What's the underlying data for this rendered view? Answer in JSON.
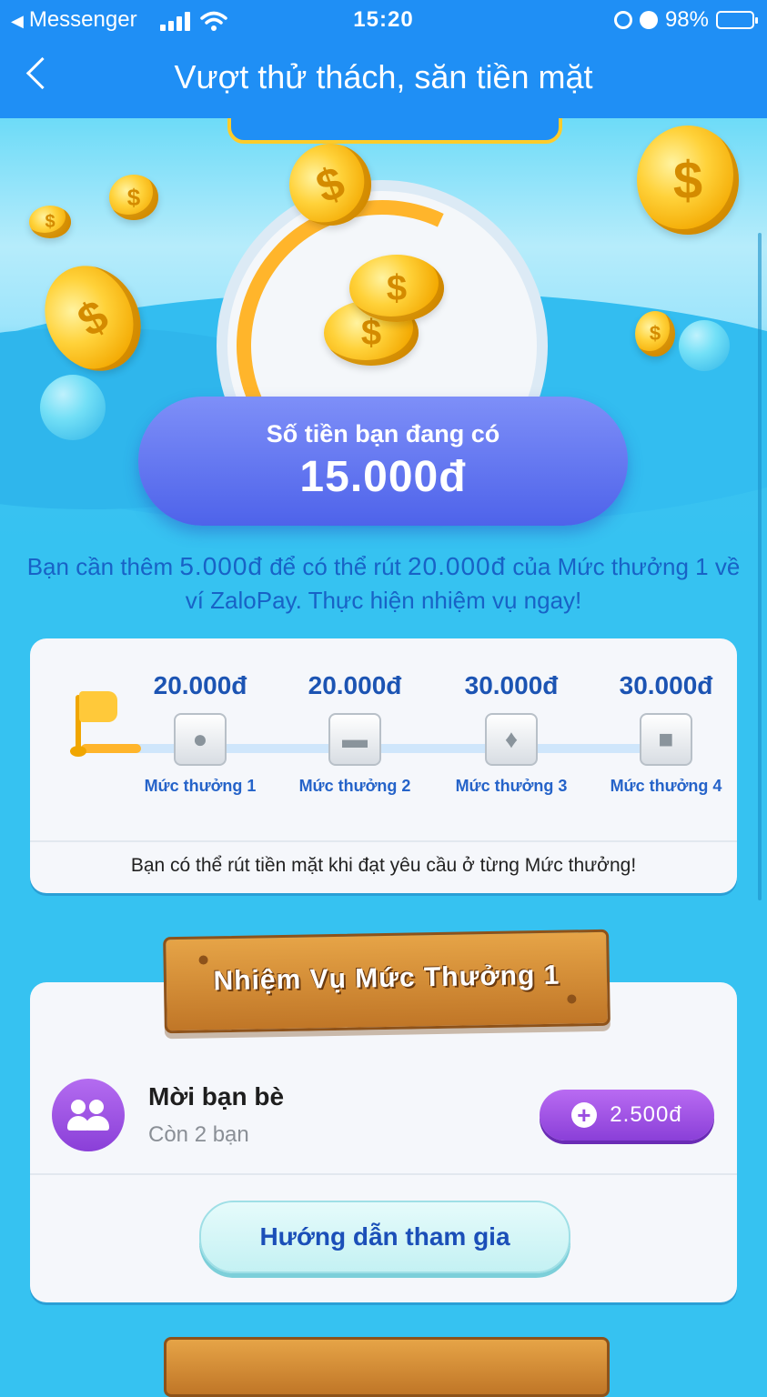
{
  "status_bar": {
    "back_app": "Messenger",
    "time": "15:20",
    "battery": "98%"
  },
  "header": {
    "title": "Vượt thử thách, săn tiền mặt"
  },
  "hero": {
    "coin_symbol": "$"
  },
  "balance": {
    "label": "Số tiền bạn đang có",
    "amount": "15.000đ"
  },
  "need_message": {
    "part1": "Bạn cần thêm ",
    "need_amount": "5.000đ",
    "part2": " để có thể rút ",
    "withdraw_amount": "20.000đ",
    "part3": " của Mức thưởng 1 về ví ZaloPay. Thực hiện nhiệm vụ ngay!"
  },
  "levels": {
    "progress_fraction": 0.1,
    "items": [
      {
        "amount": "20.000đ",
        "name": "Mức thưởng 1",
        "icon": "coins-icon"
      },
      {
        "amount": "20.000đ",
        "name": "Mức thưởng 2",
        "icon": "gold-bar-icon"
      },
      {
        "amount": "30.000đ",
        "name": "Mức thưởng 3",
        "icon": "money-bag-icon"
      },
      {
        "amount": "30.000đ",
        "name": "Mức thưởng 4",
        "icon": "treasure-chest-icon"
      }
    ],
    "note": "Bạn có thể rút tiền mặt khi đạt yêu cầu ở từng Mức thưởng!"
  },
  "mission": {
    "banner": "Nhiệm Vụ Mức Thưởng 1",
    "task": {
      "title": "Mời bạn bè",
      "subtitle": "Còn 2 bạn",
      "reward": "2.500đ",
      "icon": "friends-icon"
    },
    "guide_button": "Hướng dẫn tham gia"
  },
  "colors": {
    "header_bg": "#1f8ff5",
    "page_bg": "#36c2f1",
    "balance_pill": "#5b6ff0",
    "level_text": "#1c54b3",
    "reward_button": "#a355e6",
    "progress_fill": "#ffb52b"
  }
}
